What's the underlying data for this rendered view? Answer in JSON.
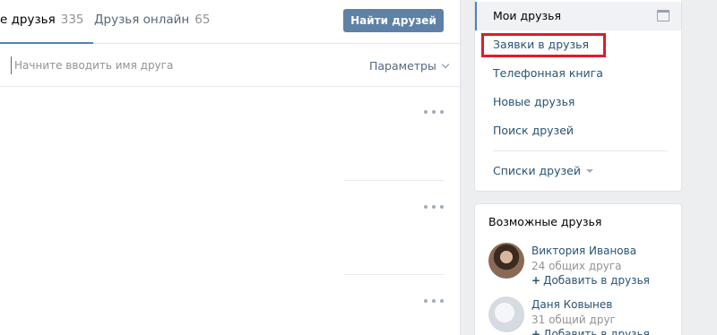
{
  "tabs": [
    {
      "label": "е друзья",
      "count": "335"
    },
    {
      "label": "Друзья онлайн",
      "count": "65"
    }
  ],
  "find_button": "Найти друзей",
  "search": {
    "placeholder": "Начните вводить имя друга",
    "value": ""
  },
  "params_label": "Параметры",
  "friend_rows": [
    {
      "menu_icon": "more-dots-icon"
    },
    {
      "menu_icon": "more-dots-icon"
    },
    {
      "menu_icon": "more-dots-icon"
    }
  ],
  "menu": {
    "items": [
      {
        "label": "Мои друзья",
        "active": true,
        "icon": "calendar-icon"
      },
      {
        "label": "Заявки в друзья",
        "highlighted": true
      },
      {
        "label": "Телефонная книга"
      },
      {
        "label": "Новые друзья"
      },
      {
        "label": "Поиск друзей"
      }
    ],
    "lists_label": "Списки друзей"
  },
  "possible_friends": {
    "title": "Возможные друзья",
    "add_label": "Добавить в друзья",
    "people": [
      {
        "name": "Виктория Иванова",
        "mutual": "24 общих друга"
      },
      {
        "name": "Даня Ковынев",
        "mutual": "31 общий друг"
      }
    ]
  },
  "colors": {
    "accent": "#5181b8",
    "button": "#5e81a8",
    "highlight": "#e11b2a",
    "link": "#285473"
  }
}
